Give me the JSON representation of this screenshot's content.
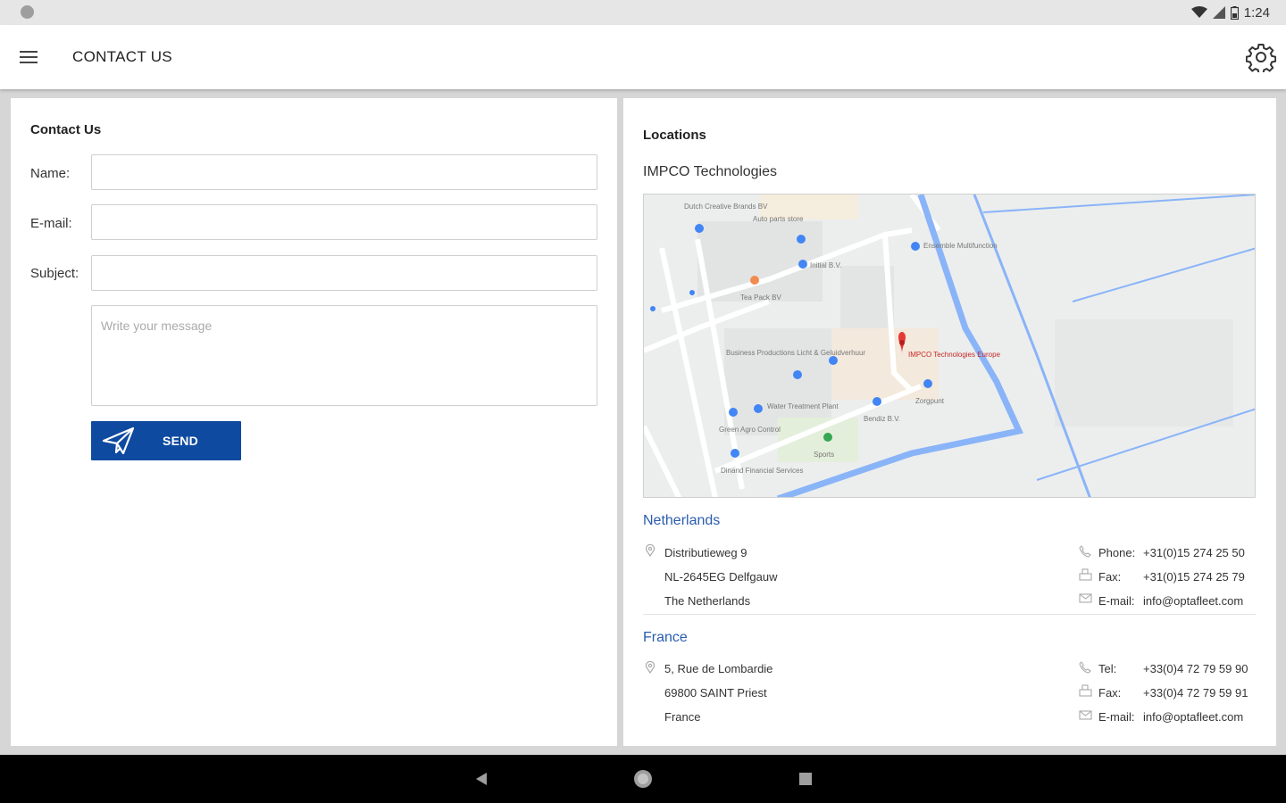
{
  "status": {
    "time": "1:24"
  },
  "appbar": {
    "title": "CONTACT US"
  },
  "contact_form": {
    "title": "Contact Us",
    "name_label": "Name:",
    "email_label": "E-mail:",
    "subject_label": "Subject:",
    "name_value": "",
    "email_value": "",
    "subject_value": "",
    "message_placeholder": "Write your message",
    "send_label": "SEND"
  },
  "locations": {
    "title": "Locations",
    "company": "IMPCO Technologies",
    "map": {
      "labels": {
        "dutch_creative": "Dutch Creative Brands BV",
        "auto_parts": "Auto parts store",
        "ensemble": "Ensemble Multifunction",
        "initial": "Initial B.V.",
        "tea_pack": "Tea Pack BV",
        "impco": "IMPCO Technologies Europe",
        "business_productions": "Business Productions Licht & Geluidverhuur",
        "water_treatment": "Water Treatment Plant",
        "green_agro": "Green Agro Control",
        "zorgpunt": "Zorgpunt",
        "bendiz": "Bendiz B.V.",
        "sports": "Sports",
        "dinand": "Dinand Financial Services"
      }
    },
    "offices": [
      {
        "country": "Netherlands",
        "address": [
          "Distributieweg 9",
          "NL-2645EG Delfgauw",
          "The Netherlands"
        ],
        "contacts": [
          {
            "label": "Phone:",
            "value": "+31(0)15 274 25 50"
          },
          {
            "label": "Fax:",
            "value": "+31(0)15 274 25 79"
          },
          {
            "label": "E-mail:",
            "value": "info@optafleet.com"
          }
        ]
      },
      {
        "country": "France",
        "address": [
          "5, Rue de Lombardie",
          "69800 SAINT Priest",
          "France"
        ],
        "contacts": [
          {
            "label": "Tel:",
            "value": "+33(0)4 72 79 59 90"
          },
          {
            "label": "Fax:",
            "value": "+33(0)4 72 79 59 91"
          },
          {
            "label": "E-mail:",
            "value": "info@optafleet.com"
          }
        ]
      }
    ]
  },
  "colors": {
    "accent": "#0d4aa0",
    "country_link": "#2a5db0",
    "map_pin_primary": "#e53935",
    "map_pin_blue": "#4285f4",
    "map_canal": "#8ab4f8"
  }
}
